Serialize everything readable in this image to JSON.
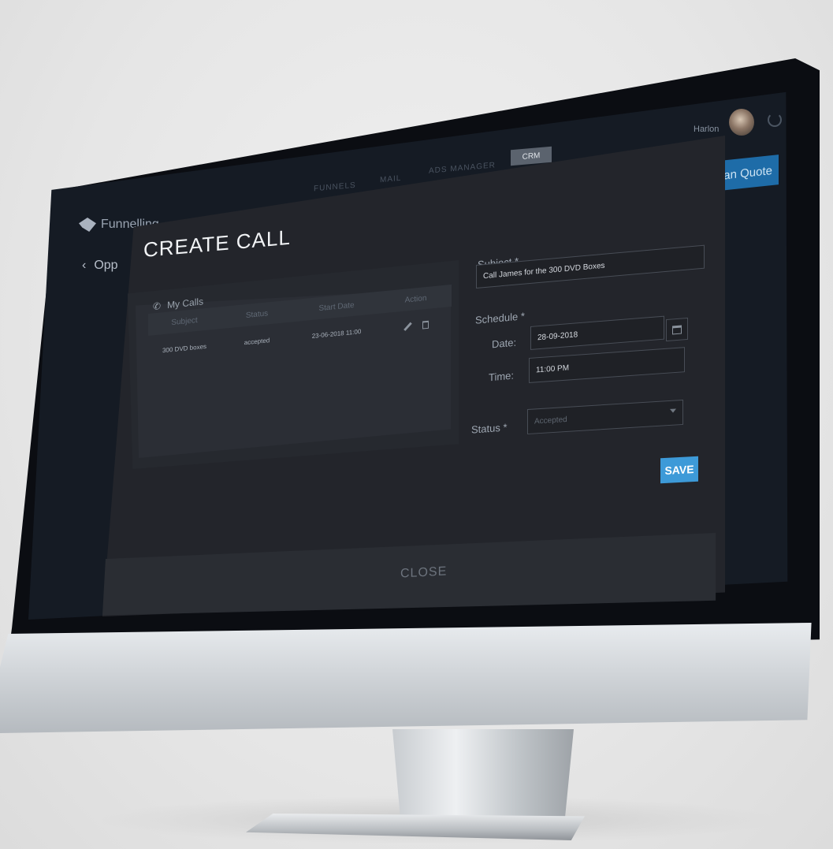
{
  "app": {
    "brand": "Funnelling",
    "back_label": "Opp",
    "nav": [
      "FUNNELS",
      "MAIL",
      "ADS MANAGER",
      "CRM"
    ],
    "active_nav": "CRM",
    "user_name": "Harlon",
    "quote_button_label": "an Quote"
  },
  "modal": {
    "title": "CREATE CALL",
    "close_label": "CLOSE",
    "calls_panel": {
      "header": "My Calls",
      "columns": [
        "Subject",
        "Status",
        "Start Date",
        "Action"
      ],
      "rows": [
        {
          "subject": "300 DVD boxes",
          "status": "accepted",
          "start_date": "23-06-2018 11:00"
        }
      ]
    },
    "form": {
      "subject_label": "Subject *",
      "subject_value": "Call James for the 300 DVD Boxes",
      "schedule_label": "Schedule *",
      "date_label": "Date:",
      "date_value": "28-09-2018",
      "time_label": "Time:",
      "time_value": "11:00 PM",
      "status_label": "Status *",
      "status_value": "Accepted",
      "save_label": "SAVE"
    }
  },
  "colors": {
    "accent": "#3d9ad8",
    "modal_bg": "#23252b",
    "quote_button": "#1e6ca8"
  }
}
